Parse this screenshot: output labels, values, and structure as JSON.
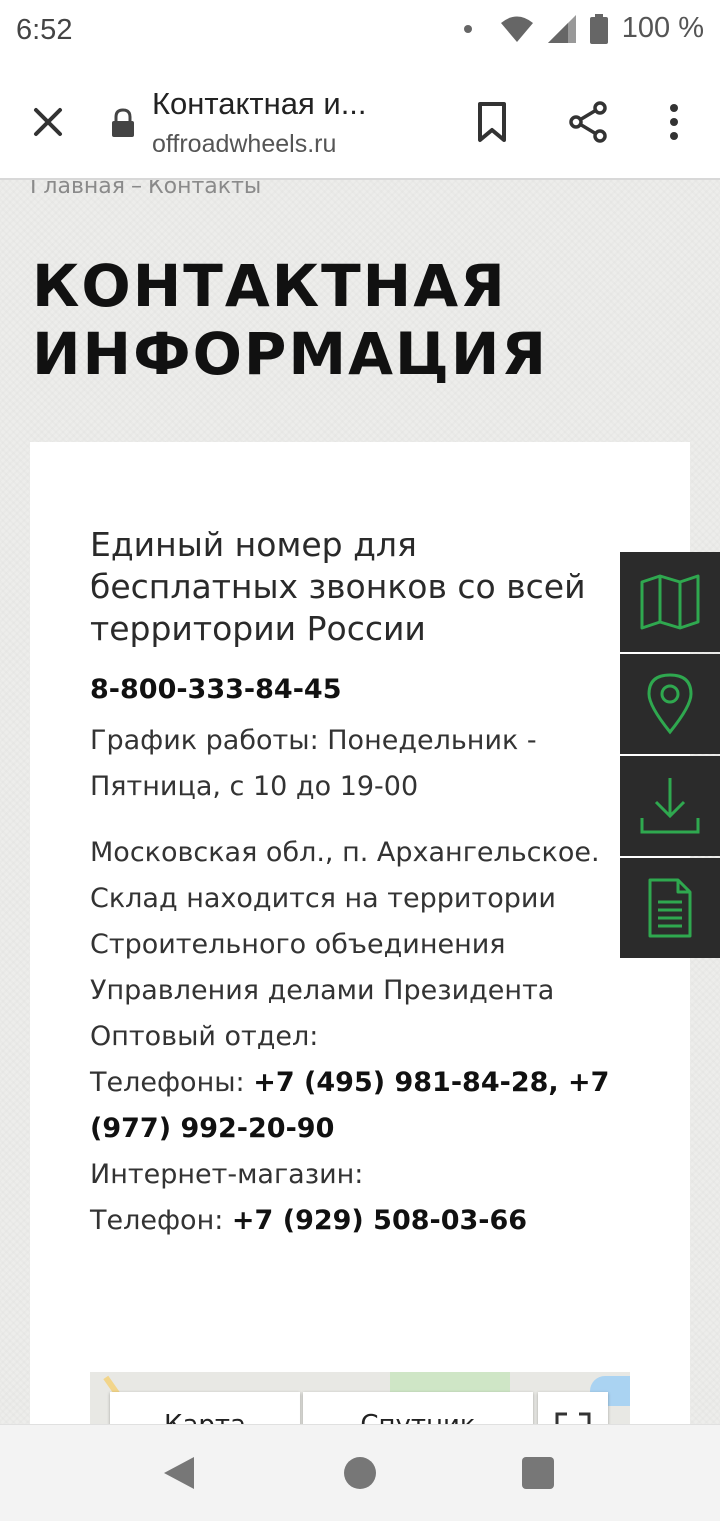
{
  "status_bar": {
    "time": "6:52",
    "battery": "100 %"
  },
  "browser": {
    "tab_title": "Контактная и...",
    "url": "offroadwheels.ru"
  },
  "breadcrumb": {
    "home": "Главная",
    "separator": "–",
    "current": "Контакты"
  },
  "page": {
    "title": "КОНТАКТНАЯ ИНФОРМАЦИЯ"
  },
  "contacts": {
    "heading": "Единый номер для бесплатных звонков со всей территории России",
    "main_phone": "8-800-333-84-45",
    "schedule": "График работы: Понедельник - Пятница, с 10 до 19-00",
    "address_lines": [
      "Московская обл., п. Архангельское.",
      "Склад находится на территории",
      "Строительного объединения",
      "Управления делами Президента"
    ],
    "wholesale_label": "Оптовый отдел:",
    "wholesale_phones_label": "Телефоны: ",
    "wholesale_phones": "+7 (495) 981-84-28, +7 (977) 992-20-90",
    "shop_label": "Интернет-магазин:",
    "shop_phone_label": "Телефон: ",
    "shop_phone": "+7 (929) 508-03-66"
  },
  "map": {
    "map_button": "Карта",
    "satellite_button": "Спутник"
  },
  "side_panel": {
    "icons": [
      "map-icon",
      "location-pin-icon",
      "download-icon",
      "document-icon"
    ],
    "accent_color": "#2fa84f"
  }
}
